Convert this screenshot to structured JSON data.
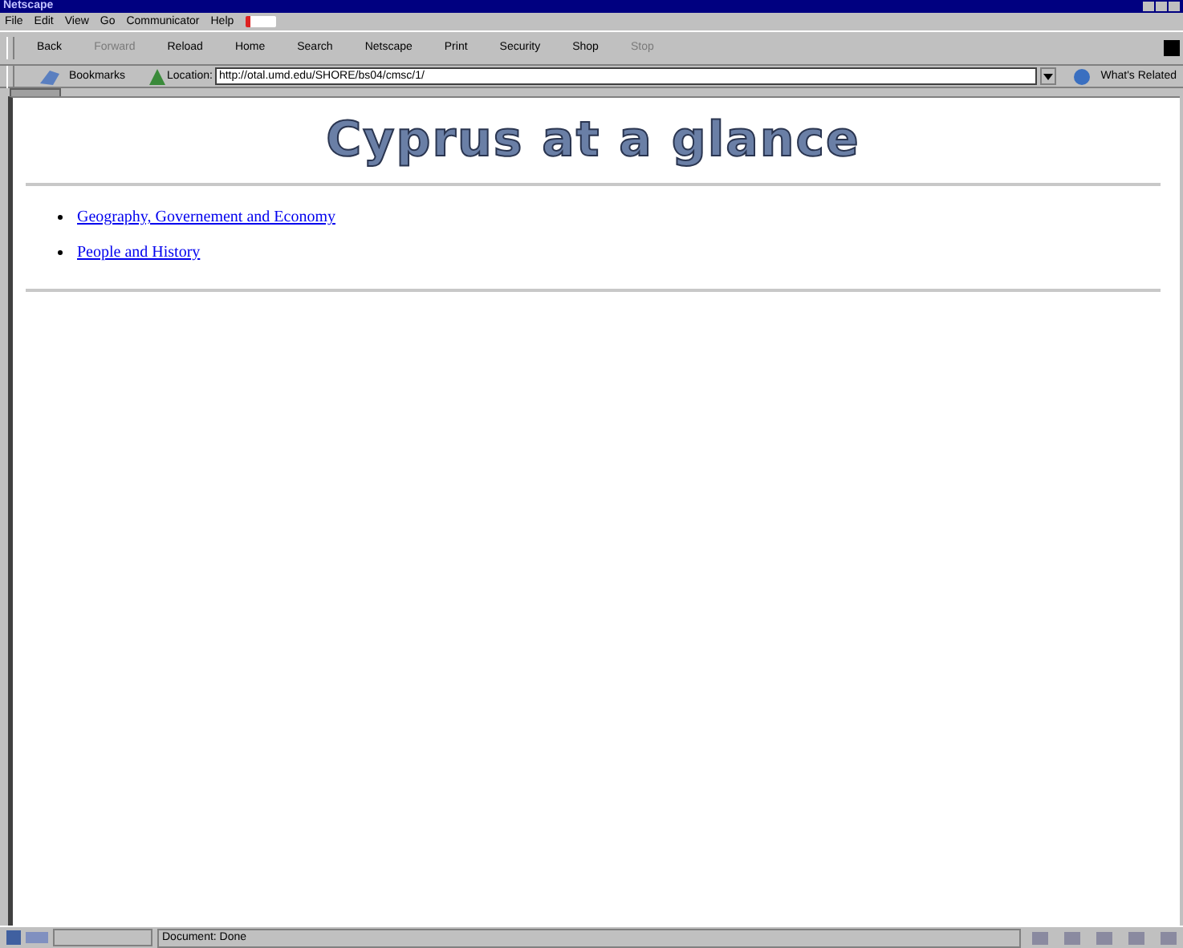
{
  "window": {
    "title": "Netscape"
  },
  "menu": [
    "File",
    "Edit",
    "View",
    "Go",
    "Communicator",
    "Help"
  ],
  "toolbar": [
    {
      "label": "Back",
      "disabled": false
    },
    {
      "label": "Forward",
      "disabled": true
    },
    {
      "label": "Reload",
      "disabled": false
    },
    {
      "label": "Home",
      "disabled": false
    },
    {
      "label": "Search",
      "disabled": false
    },
    {
      "label": "Netscape",
      "disabled": false
    },
    {
      "label": "Print",
      "disabled": false
    },
    {
      "label": "Security",
      "disabled": false
    },
    {
      "label": "Shop",
      "disabled": false
    },
    {
      "label": "Stop",
      "disabled": true
    }
  ],
  "location_bar": {
    "bookmarks": "Bookmarks",
    "label": "Location:",
    "url": "http://otal.umd.edu/SHORE/bs04/cmsc/1/",
    "related": "What's Related"
  },
  "page": {
    "heading": "Cyprus at a glance",
    "links": [
      "Geography, Governement and Economy",
      "People and History"
    ]
  },
  "status_bar": {
    "text": "Document: Done"
  }
}
